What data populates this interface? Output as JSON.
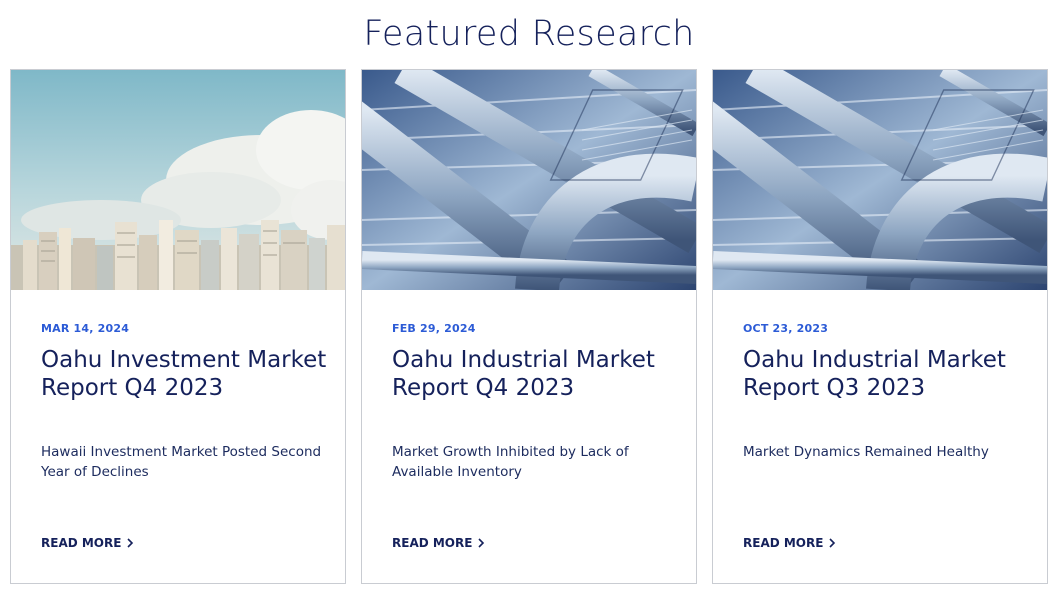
{
  "section": {
    "title": "Featured Research"
  },
  "cards": [
    {
      "date": "MAR 14, 2024",
      "title": "Oahu Investment Market Report Q4 2023",
      "description": "Hawaii Investment Market Posted Second Year of Declines",
      "link_label": "READ MORE",
      "image": "city-skyline-photo"
    },
    {
      "date": "FEB 29, 2024",
      "title": "Oahu Industrial Market Report Q4 2023",
      "description": "Market Growth Inhibited by Lack of Available Inventory",
      "link_label": "READ MORE",
      "image": "industrial-ducts-photo"
    },
    {
      "date": "OCT 23, 2023",
      "title": "Oahu Industrial Market Report Q3 2023",
      "description": "Market Dynamics Remained Healthy",
      "link_label": "READ MORE",
      "image": "industrial-ducts-photo"
    }
  ],
  "colors": {
    "navy": "#15215b",
    "date_blue": "#2c5bd6",
    "card_border": "#c9ccd2"
  }
}
